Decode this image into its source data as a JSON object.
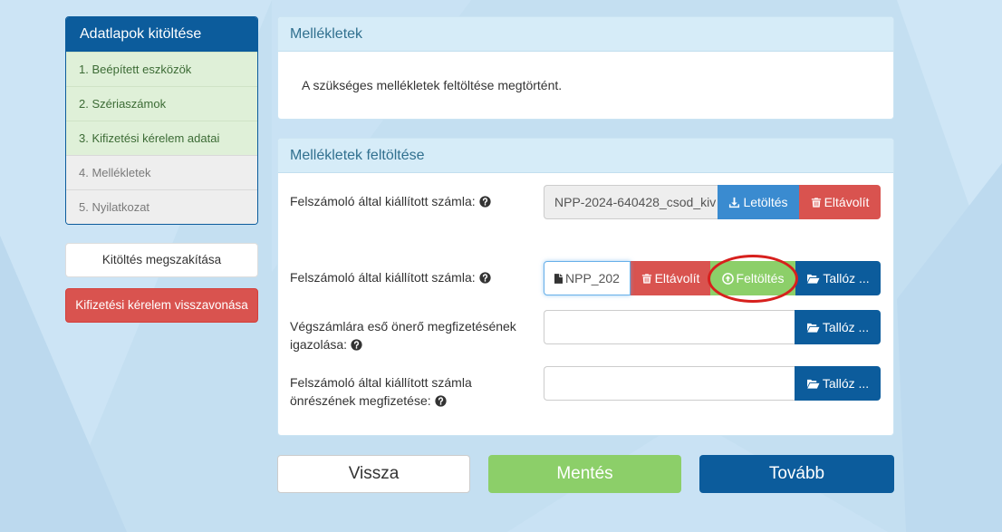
{
  "sidebar": {
    "title": "Adatlapok kitöltése",
    "steps": [
      {
        "label": "1. Beépített eszközök",
        "completed": true
      },
      {
        "label": "2. Szériaszámok",
        "completed": true
      },
      {
        "label": "3. Kifizetési kérelem adatai",
        "completed": true
      },
      {
        "label": "4. Mellékletek",
        "completed": false
      },
      {
        "label": "5. Nyilatkozat",
        "completed": false
      }
    ],
    "cancel_label": "Kitöltés megszakítása",
    "withdraw_label": "Kifizetési kérelem visszavonása"
  },
  "status_panel": {
    "title": "Mellékletek",
    "message": "A szükséges mellékletek feltöltése megtörtént."
  },
  "upload_panel": {
    "title": "Mellékletek feltöltése",
    "rows": [
      {
        "label": "Felszámoló által kiállított számla:",
        "help_icon": "question-circle-icon",
        "file_value": "NPP-2024-640428_csod_kiv",
        "download_label": "Letöltés",
        "download_icon": "download-icon",
        "remove_label": "Eltávolít",
        "remove_icon": "trash-icon"
      },
      {
        "label": "Felszámoló által kiállított számla:",
        "help_icon": "question-circle-icon",
        "file_icon": "file-icon",
        "file_value": "NPP_202",
        "remove_label": "Eltávolít",
        "remove_icon": "trash-icon",
        "upload_label": "Feltöltés",
        "upload_icon": "upload-circle-icon",
        "browse_label": "Tallóz ...",
        "browse_icon": "folder-open-icon"
      },
      {
        "label": "Végszámlára eső önerő megfizetésének igazolása:",
        "help_icon": "question-circle-icon",
        "file_value": "",
        "browse_label": "Tallóz ...",
        "browse_icon": "folder-open-icon"
      },
      {
        "label": "Felszámoló által kiállított számla önrészének megfizetése:",
        "help_icon": "question-circle-icon",
        "file_value": "",
        "browse_label": "Tallóz ...",
        "browse_icon": "folder-open-icon"
      }
    ]
  },
  "footer": {
    "back_label": "Vissza",
    "save_label": "Mentés",
    "next_label": "Tovább"
  },
  "colors": {
    "page_bg": "#c4dff1",
    "primary": "#0c5c9c",
    "info": "#3a8bd0",
    "danger": "#d9534f",
    "success": "#8ccf69",
    "panel_heading_bg": "#d6ecf8",
    "panel_heading_text": "#31708f",
    "step_done_bg": "#dff0d8",
    "step_pending_bg": "#eeeeee",
    "annotation": "#d7201d"
  }
}
